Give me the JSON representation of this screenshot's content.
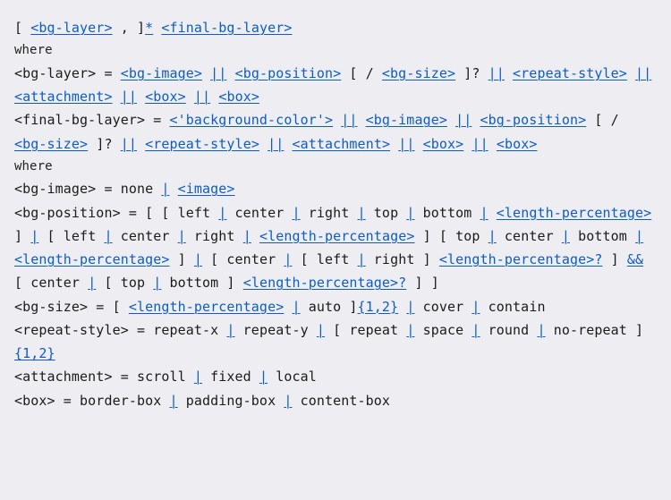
{
  "lines": [
    {
      "kind": "syntax",
      "tokens": [
        {
          "t": "[ "
        },
        {
          "t": "<bg-layer>",
          "link": true
        },
        {
          "t": " , ]"
        },
        {
          "t": "*",
          "link": true
        },
        {
          "t": " "
        },
        {
          "t": "<final-bg-layer>",
          "link": true
        }
      ]
    },
    {
      "kind": "prose",
      "text": "where"
    },
    {
      "kind": "syntax",
      "tokens": [
        {
          "t": "<bg-layer> = "
        },
        {
          "t": "<bg-image>",
          "link": true
        },
        {
          "t": " "
        },
        {
          "t": "||",
          "link": true
        },
        {
          "t": " "
        },
        {
          "t": "<bg-position>",
          "link": true
        },
        {
          "t": " [ / "
        },
        {
          "t": "<bg-size>",
          "link": true
        },
        {
          "t": " ]? "
        },
        {
          "t": "||",
          "link": true
        },
        {
          "t": " "
        },
        {
          "t": "<repeat-style>",
          "link": true
        },
        {
          "t": " "
        },
        {
          "t": "||",
          "link": true
        },
        {
          "t": " "
        },
        {
          "t": "<attachment>",
          "link": true
        },
        {
          "t": " "
        },
        {
          "t": "||",
          "link": true
        },
        {
          "t": " "
        },
        {
          "t": "<box>",
          "link": true
        },
        {
          "t": " "
        },
        {
          "t": "||",
          "link": true
        },
        {
          "t": " "
        },
        {
          "t": "<box>",
          "link": true
        }
      ]
    },
    {
      "kind": "syntax",
      "tokens": [
        {
          "t": "<final-bg-layer> = "
        },
        {
          "t": "<'background-color'>",
          "link": true
        },
        {
          "t": " "
        },
        {
          "t": "||",
          "link": true
        },
        {
          "t": " "
        },
        {
          "t": "<bg-image>",
          "link": true
        },
        {
          "t": " "
        },
        {
          "t": "||",
          "link": true
        },
        {
          "t": " "
        },
        {
          "t": "<bg-position>",
          "link": true
        },
        {
          "t": " [ / "
        },
        {
          "t": "<bg-size>",
          "link": true
        },
        {
          "t": " ]? "
        },
        {
          "t": "||",
          "link": true
        },
        {
          "t": " "
        },
        {
          "t": "<repeat-style>",
          "link": true
        },
        {
          "t": " "
        },
        {
          "t": "||",
          "link": true
        },
        {
          "t": " "
        },
        {
          "t": "<attachment>",
          "link": true
        },
        {
          "t": " "
        },
        {
          "t": "||",
          "link": true
        },
        {
          "t": " "
        },
        {
          "t": "<box>",
          "link": true
        },
        {
          "t": " "
        },
        {
          "t": "||",
          "link": true
        },
        {
          "t": " "
        },
        {
          "t": "<box>",
          "link": true
        }
      ]
    },
    {
      "kind": "prose",
      "text": "where"
    },
    {
      "kind": "syntax",
      "tokens": [
        {
          "t": "<bg-image> = none "
        },
        {
          "t": "|",
          "link": true
        },
        {
          "t": " "
        },
        {
          "t": "<image>",
          "link": true
        }
      ]
    },
    {
      "kind": "syntax",
      "tokens": [
        {
          "t": "<bg-position> = [ [ left "
        },
        {
          "t": "|",
          "link": true
        },
        {
          "t": " center "
        },
        {
          "t": "|",
          "link": true
        },
        {
          "t": " right "
        },
        {
          "t": "|",
          "link": true
        },
        {
          "t": " top "
        },
        {
          "t": "|",
          "link": true
        },
        {
          "t": " bottom "
        },
        {
          "t": "|",
          "link": true
        },
        {
          "t": " "
        },
        {
          "t": "<length-percentage>",
          "link": true
        },
        {
          "t": " ] "
        },
        {
          "t": "|",
          "link": true
        },
        {
          "t": " [ left "
        },
        {
          "t": "|",
          "link": true
        },
        {
          "t": " center "
        },
        {
          "t": "|",
          "link": true
        },
        {
          "t": " right "
        },
        {
          "t": "|",
          "link": true
        },
        {
          "t": " "
        },
        {
          "t": "<length-percentage>",
          "link": true
        },
        {
          "t": " ] [ top "
        },
        {
          "t": "|",
          "link": true
        },
        {
          "t": " center "
        },
        {
          "t": "|",
          "link": true
        },
        {
          "t": " bottom "
        },
        {
          "t": "|",
          "link": true
        },
        {
          "t": " "
        },
        {
          "t": "<length-percentage>",
          "link": true
        },
        {
          "t": " ] "
        },
        {
          "t": "|",
          "link": true
        },
        {
          "t": " [ center "
        },
        {
          "t": "|",
          "link": true
        },
        {
          "t": " [ left "
        },
        {
          "t": "|",
          "link": true
        },
        {
          "t": " right ] "
        },
        {
          "t": "<length-percentage>?",
          "link": true
        },
        {
          "t": " ] "
        },
        {
          "t": "&&",
          "link": true
        },
        {
          "t": " [ center "
        },
        {
          "t": "|",
          "link": true
        },
        {
          "t": " [ top "
        },
        {
          "t": "|",
          "link": true
        },
        {
          "t": " bottom ] "
        },
        {
          "t": "<length-percentage>?",
          "link": true
        },
        {
          "t": " ] ]"
        }
      ]
    },
    {
      "kind": "syntax",
      "tokens": [
        {
          "t": "<bg-size> = [ "
        },
        {
          "t": "<length-percentage>",
          "link": true
        },
        {
          "t": " "
        },
        {
          "t": "|",
          "link": true
        },
        {
          "t": " auto ]"
        },
        {
          "t": "{1,2}",
          "link": true
        },
        {
          "t": " "
        },
        {
          "t": "|",
          "link": true
        },
        {
          "t": " cover "
        },
        {
          "t": "|",
          "link": true
        },
        {
          "t": " contain"
        }
      ]
    },
    {
      "kind": "syntax",
      "tokens": [
        {
          "t": "<repeat-style> = repeat-x "
        },
        {
          "t": "|",
          "link": true
        },
        {
          "t": " repeat-y "
        },
        {
          "t": "|",
          "link": true
        },
        {
          "t": " [ repeat "
        },
        {
          "t": "|",
          "link": true
        },
        {
          "t": " space "
        },
        {
          "t": "|",
          "link": true
        },
        {
          "t": " round "
        },
        {
          "t": "|",
          "link": true
        },
        {
          "t": " no-repeat ]"
        },
        {
          "t": "{1,2}",
          "link": true
        }
      ]
    },
    {
      "kind": "syntax",
      "tokens": [
        {
          "t": "<attachment> = scroll "
        },
        {
          "t": "|",
          "link": true
        },
        {
          "t": " fixed "
        },
        {
          "t": "|",
          "link": true
        },
        {
          "t": " local"
        }
      ]
    },
    {
      "kind": "syntax",
      "tokens": [
        {
          "t": "<box> = border-box "
        },
        {
          "t": "|",
          "link": true
        },
        {
          "t": " padding-box "
        },
        {
          "t": "|",
          "link": true
        },
        {
          "t": " content-box"
        }
      ]
    }
  ]
}
